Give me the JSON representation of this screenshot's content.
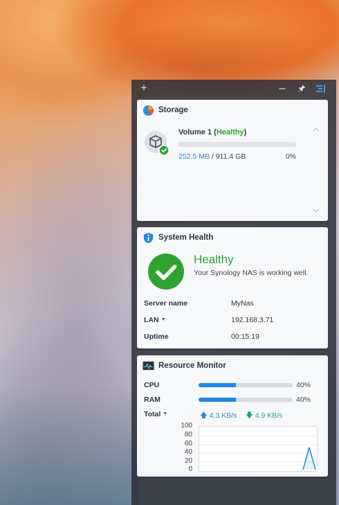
{
  "toolbar": {
    "add": "+",
    "minimize": "–"
  },
  "storage": {
    "title": "Storage",
    "volume_name": "Volume 1 (",
    "volume_status": "Healthy",
    "volume_close": ")",
    "used": "252.5 MB",
    "separator": " / ",
    "total": "911.4 GB",
    "percent_label": "0%",
    "percent_value": 0.0003
  },
  "health": {
    "title": "System Health",
    "status": "Healthy",
    "message": "Your Synology NAS is working well.",
    "server_name_label": "Server name",
    "server_name": "MyNas",
    "lan_label": "LAN",
    "lan_ip": "192.168.3.71",
    "uptime_label": "Uptime",
    "uptime": "00:15:19"
  },
  "resource": {
    "title": "Resource Monitor",
    "cpu_label": "CPU",
    "cpu_pct": "40%",
    "cpu_value": 0.4,
    "ram_label": "RAM",
    "ram_pct": "40%",
    "ram_value": 0.4,
    "total_label": "Total",
    "upload": "4.3 KB/s",
    "download": "4.9 KB/s",
    "graph_axis": [
      "100",
      "80",
      "60",
      "40",
      "20",
      "0"
    ]
  },
  "colors": {
    "healthy": "#2fa22f",
    "accent": "#1e88e5"
  }
}
